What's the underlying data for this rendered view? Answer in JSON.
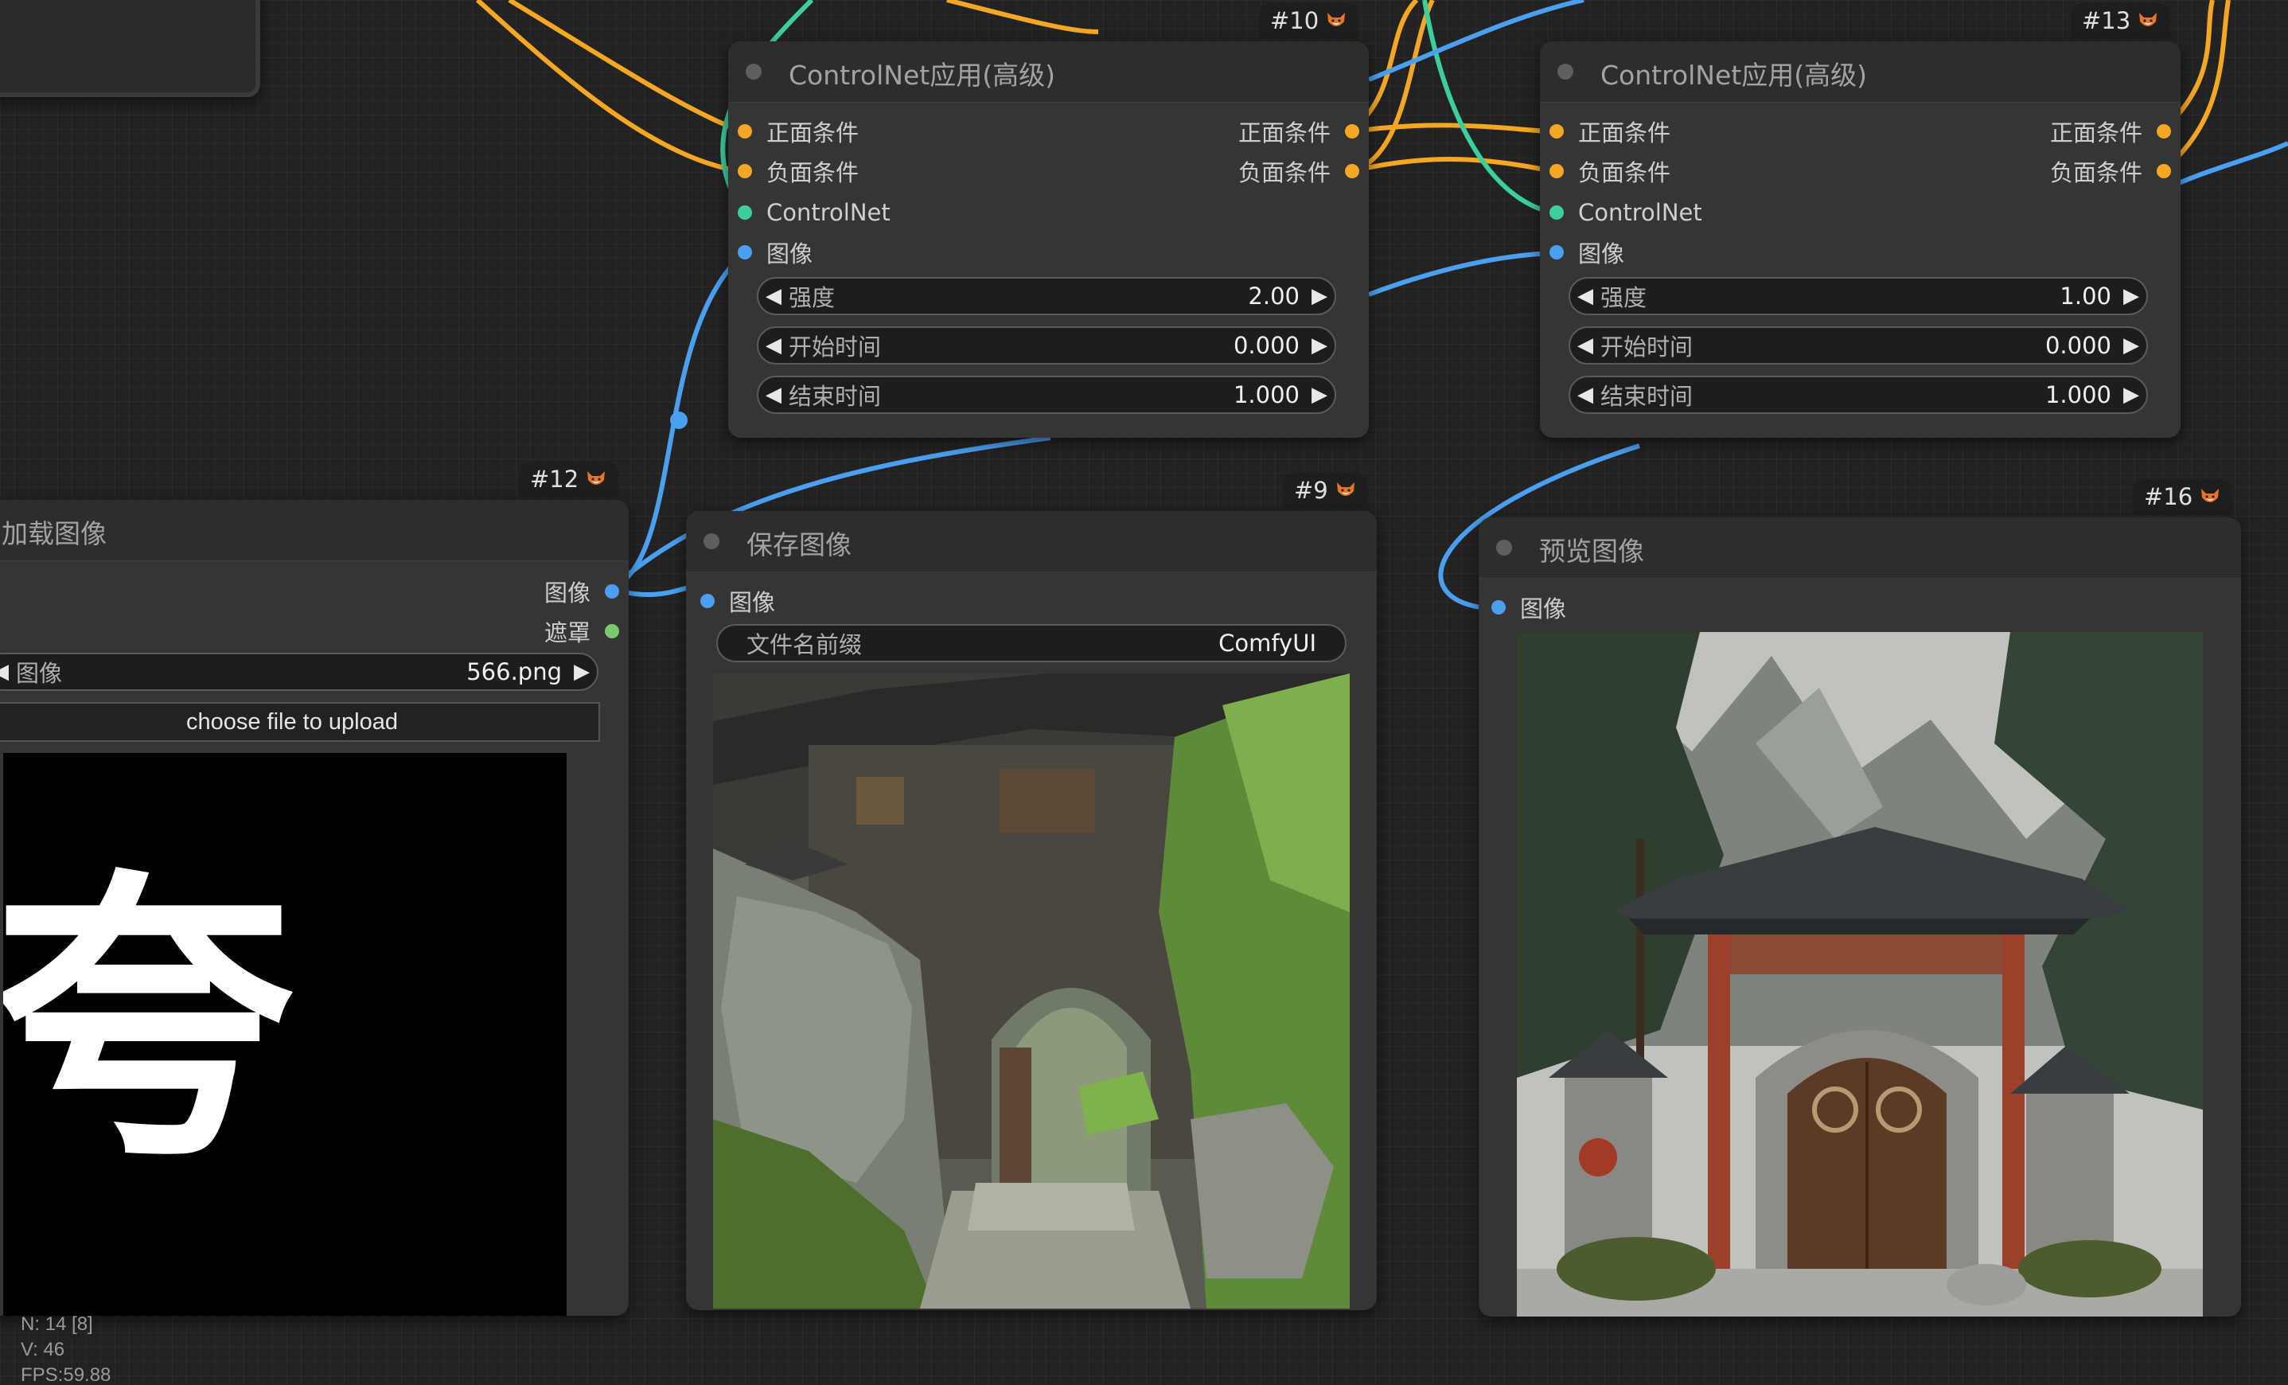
{
  "nodes": {
    "controlnet_a": {
      "id": "#10",
      "title": "ControlNet应用(高级)",
      "inputs": [
        "正面条件",
        "负面条件",
        "ControlNet",
        "图像"
      ],
      "outputs": [
        "正面条件",
        "负面条件"
      ],
      "widgets": [
        {
          "label": "强度",
          "value": "2.00"
        },
        {
          "label": "开始时间",
          "value": "0.000"
        },
        {
          "label": "结束时间",
          "value": "1.000"
        }
      ]
    },
    "controlnet_b": {
      "id": "#13",
      "title": "ControlNet应用(高级)",
      "inputs": [
        "正面条件",
        "负面条件",
        "ControlNet",
        "图像"
      ],
      "outputs": [
        "正面条件",
        "负面条件"
      ],
      "widgets": [
        {
          "label": "强度",
          "value": "1.00"
        },
        {
          "label": "开始时间",
          "value": "0.000"
        },
        {
          "label": "结束时间",
          "value": "1.000"
        }
      ]
    },
    "load_image": {
      "id": "#12",
      "title": "加载图像",
      "outputs": [
        "图像",
        "遮罩"
      ],
      "widget": {
        "label": "图像",
        "value": "566.png"
      },
      "upload_label": "choose file to upload",
      "preview_char": "夸"
    },
    "save_image": {
      "id": "#9",
      "title": "保存图像",
      "inputs": [
        "图像"
      ],
      "widget": {
        "label": "文件名前缀",
        "value": "ComfyUI"
      }
    },
    "preview_image": {
      "id": "#16",
      "title": "预览图像",
      "inputs": [
        "图像"
      ]
    }
  },
  "status": {
    "nodes": "N: 14 [8]",
    "vertices": "V: 46",
    "fps": "FPS:59.88"
  },
  "colors": {
    "conditioning": "#f5a623",
    "controlnet": "#3ccf9c",
    "image": "#4a9ff0",
    "mask": "#7ac96b"
  }
}
